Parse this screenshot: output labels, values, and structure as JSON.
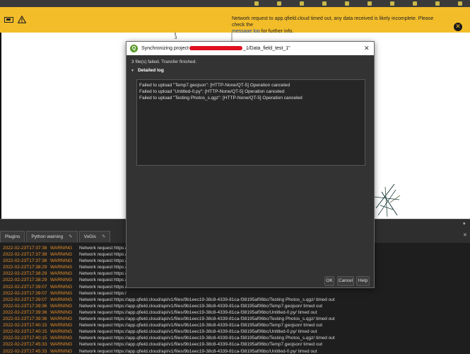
{
  "message_bar": {
    "text": "Network request to app.qfield.cloud timed out, any data received is likely incomplete. Please check the",
    "link": "message log",
    "suffix": "for further info.",
    "close_glyph": "✕",
    "icons": [
      "battery-icon",
      "warning-icon"
    ],
    "background": "#f3bd2a"
  },
  "canvas": {
    "label": "3"
  },
  "dialog": {
    "title_prefix": "Synchronizing project",
    "title_suffix": "_1/Data_field_test_1\"",
    "summary": "3 file(s) failed. Transfer finished.",
    "section_label": "Detailed log",
    "log_lines": [
      "Failed to upload \"Temp7.geojson\": [HTTP-None/QT-5] Operation canceled",
      "Failed to upload \"Untitled-0.py\": [HTTP-None/QT-5] Operation canceled",
      "Failed to upload \"Testing Photos_s.qgz\": [HTTP-None/QT-5] Operation canceled"
    ],
    "buttons": {
      "ok": "OK",
      "cancel": "Cancel",
      "help": "Help"
    },
    "close_glyph": "✕"
  },
  "dock": {
    "tabs": [
      {
        "label": "Plugins",
        "tool": ""
      },
      {
        "label": "Python warning",
        "tool": "✎"
      },
      {
        "label": "VoGis",
        "tool": "✎"
      }
    ],
    "controls": {
      "minimize": "▾",
      "close": "✕"
    },
    "log_rows": [
      {
        "ts": "2022-02-23T17:37:38",
        "level": "WARNING",
        "msg": "Network request https:/"
      },
      {
        "ts": "2022-02-23T17:37:38",
        "level": "WARNING",
        "msg": "Network request https:/"
      },
      {
        "ts": "2022-02-23T17:37:38",
        "level": "WARNING",
        "msg": "Network request https:/"
      },
      {
        "ts": "2022-02-23T17:38:29",
        "level": "WARNING",
        "msg": "Network request https:/"
      },
      {
        "ts": "2022-02-23T17:38:29",
        "level": "WARNING",
        "msg": "Network request https:/"
      },
      {
        "ts": "2022-02-23T17:38:29",
        "level": "WARNING",
        "msg": "Network request https:/"
      },
      {
        "ts": "2022-02-23T17:39:07",
        "level": "WARNING",
        "msg": "Network request https:/"
      },
      {
        "ts": "2022-02-23T17:39:07",
        "level": "WARNING",
        "msg": "Network request https:/"
      },
      {
        "ts": "2022-02-23T17:39:07",
        "level": "WARNING",
        "msg": "Network request https://app.qfield.cloud/api/v1/files/9b1eec19-38c8-4339-81ca-f38195af06bc/Testing Photos_s.qgz/ timed out"
      },
      {
        "ts": "2022-02-23T17:39:36",
        "level": "WARNING",
        "msg": "Network request https://app.qfield.cloud/api/v1/files/9b1eec19-38c8-4339-81ca-f38195af06bc/Temp7.geojson/ timed out"
      },
      {
        "ts": "2022-02-23T17:39:36",
        "level": "WARNING",
        "msg": "Network request https://app.qfield.cloud/api/v1/files/9b1eec19-38c8-4339-81ca-f38195af06bc/Untitled-0.py/ timed out"
      },
      {
        "ts": "2022-02-23T17:39:36",
        "level": "WARNING",
        "msg": "Network request https://app.qfield.cloud/api/v1/files/9b1eec19-38c8-4339-81ca-f38195af06bc/Testing Photos_s.qgz/ timed out"
      },
      {
        "ts": "2022-02-23T17:40:15",
        "level": "WARNING",
        "msg": "Network request https://app.qfield.cloud/api/v1/files/9b1eec19-38c8-4339-81ca-f38195af06bc/Temp7.geojson/ timed out"
      },
      {
        "ts": "2022-02-23T17:40:15",
        "level": "WARNING",
        "msg": "Network request https://app.qfield.cloud/api/v1/files/9b1eec19-38c8-4339-81ca-f38195af06bc/Untitled-0.py/ timed out"
      },
      {
        "ts": "2022-02-23T17:40:15",
        "level": "WARNING",
        "msg": "Network request https://app.qfield.cloud/api/v1/files/9b1eec19-38c8-4339-81ca-f38195af06bc/Testing Photos_s.qgz/ timed out"
      },
      {
        "ts": "2022-02-23T17:45:33",
        "level": "WARNING",
        "msg": "Network request https://app.qfield.cloud/api/v1/files/9b1eec19-38c8-4339-81ca-f38195af06bc/Temp7.geojson/ timed out"
      },
      {
        "ts": "2022-02-23T17:45:33",
        "level": "WARNING",
        "msg": "Network request https://app.qfield.cloud/api/v1/files/9b1eec19-38c8-4339-81ca-f38195af06bc/Untitled-0.py/ timed out"
      },
      {
        "ts": "2022-02-23T17:45:33",
        "level": "WARNING",
        "msg": "Network request https://app.qfield.cloud/api/v1/files/9b1eec19-38c8-4339-81ca-f38195af06bc/Testing Photos_s.qgz/ timed out"
      }
    ],
    "colors": {
      "timestamp": "#e8912d",
      "level": "#e8912d"
    }
  }
}
